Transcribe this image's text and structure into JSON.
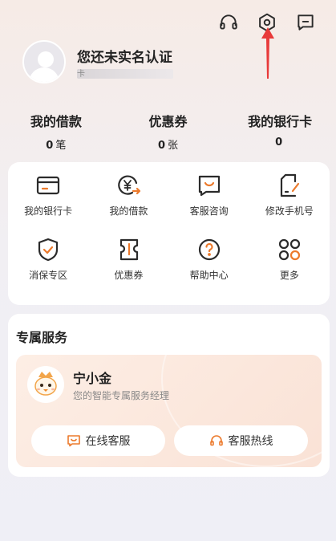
{
  "colors": {
    "accent": "#ec7a2c",
    "icon_dark": "#2b2b2b",
    "arrow": "#e83a3a"
  },
  "header": {
    "icons": [
      "headset-icon",
      "settings-icon",
      "message-icon"
    ]
  },
  "profile": {
    "name": "您还未实名认证",
    "sub_prefix": "卡"
  },
  "stats": [
    {
      "label": "我的借款",
      "value": "0",
      "unit": "笔"
    },
    {
      "label": "优惠券",
      "value": "0",
      "unit": "张"
    },
    {
      "label": "我的银行卡",
      "value": "0",
      "unit": ""
    }
  ],
  "grid": [
    {
      "label": "我的银行卡",
      "icon": "bank-card-icon"
    },
    {
      "label": "我的借款",
      "icon": "loan-icon"
    },
    {
      "label": "客服咨询",
      "icon": "chat-icon"
    },
    {
      "label": "修改手机号",
      "icon": "phone-edit-icon"
    },
    {
      "label": "消保专区",
      "icon": "shield-icon"
    },
    {
      "label": "优惠券",
      "icon": "coupon-icon"
    },
    {
      "label": "帮助中心",
      "icon": "help-icon"
    },
    {
      "label": "更多",
      "icon": "more-icon"
    }
  ],
  "service": {
    "title": "专属服务",
    "manager_name": "宁小金",
    "manager_desc": "您的智能专属服务经理",
    "online_label": "在线客服",
    "hotline_label": "客服热线"
  }
}
